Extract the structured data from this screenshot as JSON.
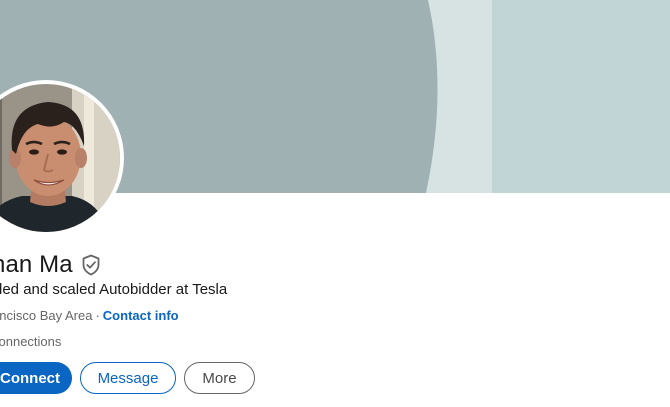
{
  "profile": {
    "name": "han Ma",
    "headline": "ded and scaled Autobidder at Tesla",
    "location": "ancisco Bay Area",
    "separator": "·",
    "contact_info_label": "Contact info",
    "connections": "connections",
    "verified_icon": "shield-check-icon",
    "avatar_icon": "profile-photo"
  },
  "actions": {
    "connect_label": "Connect",
    "message_label": "Message",
    "more_label": "More"
  },
  "colors": {
    "cover_main": "#9fb1b3",
    "cover_light": "#d7e3e3",
    "cover_right": "#c1d4d6",
    "link_blue": "#0a66c2",
    "secondary_text": "#666666"
  }
}
